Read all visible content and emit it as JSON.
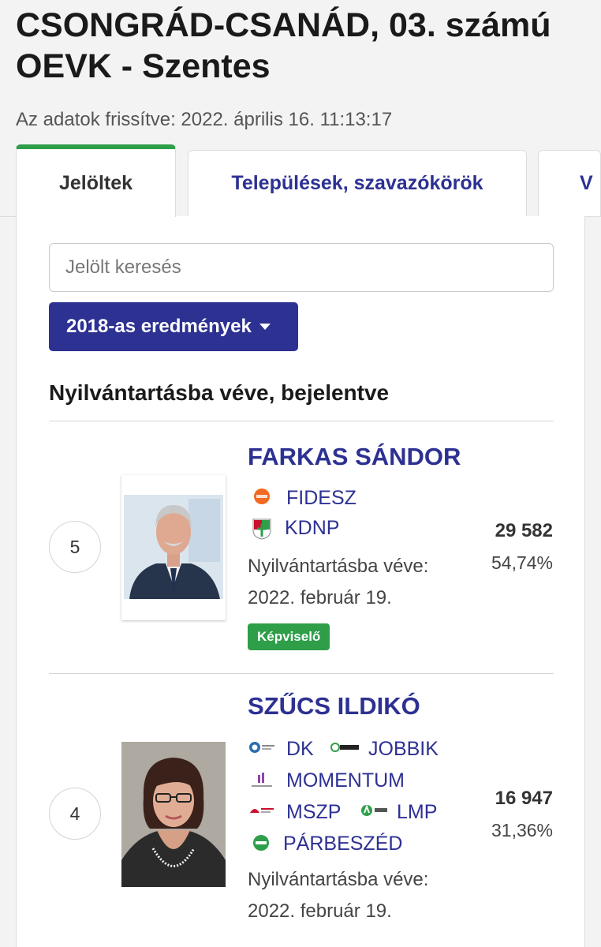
{
  "header": {
    "title": "CSONGRÁD-CSANÁD, 03. számú OEVK - Szentes",
    "updated": "Az adatok frissítve: 2022. április 16. 11:13:17"
  },
  "tabs": [
    {
      "label": "Jelöltek",
      "active": true
    },
    {
      "label": "Települések, szavazókörök",
      "active": false
    },
    {
      "label": "V",
      "active": false
    }
  ],
  "search": {
    "placeholder": "Jelölt keresés"
  },
  "results_dropdown": {
    "label": "2018-as eredmények"
  },
  "section": {
    "title": "Nyilvántartásba véve, bejelentve"
  },
  "candidates": [
    {
      "number": "5",
      "name": "FARKAS SÁNDOR",
      "parties": [
        "FIDESZ",
        "KDNP"
      ],
      "registered_label": "Nyilvántartásba véve:",
      "registered_date": "2022. február 19.",
      "votes": "29 582",
      "percent": "54,74%",
      "badge": "Képviselő"
    },
    {
      "number": "4",
      "name": "SZŰCS ILDIKÓ",
      "parties": [
        "DK",
        "JOBBIK",
        "MOMENTUM",
        "MSZP",
        "LMP",
        "PÁRBESZÉD"
      ],
      "registered_label": "Nyilvántartásba véve:",
      "registered_date": "2022. február 19.",
      "votes": "16 947",
      "percent": "31,36%"
    }
  ],
  "colors": {
    "brand_blue": "#2d3192",
    "active_tab_accent": "#2e9e49",
    "badge_green": "#2e9e49",
    "fidesz_orange": "#f26a21"
  }
}
